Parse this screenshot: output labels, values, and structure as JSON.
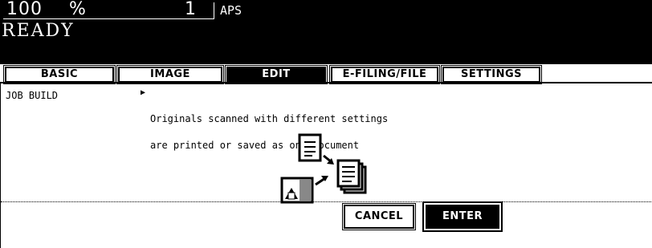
{
  "header": {
    "zoom_value": "100",
    "zoom_unit": "%",
    "copies": "1",
    "paper": "APS",
    "status": "READY"
  },
  "tabs": [
    {
      "label": "BASIC",
      "active": false
    },
    {
      "label": "IMAGE",
      "active": false
    },
    {
      "label": "EDIT",
      "active": true
    },
    {
      "label": "E-FILING/FILE",
      "active": false
    },
    {
      "label": "SETTINGS",
      "active": false
    }
  ],
  "function": {
    "label": "JOB BUILD",
    "description_line1": "Originals scanned with different settings",
    "description_line2": "are printed or saved as one document",
    "illustration_icon": "job-build-documents-icon"
  },
  "buttons": {
    "cancel_label": "CANCEL",
    "enter_label": "ENTER"
  }
}
